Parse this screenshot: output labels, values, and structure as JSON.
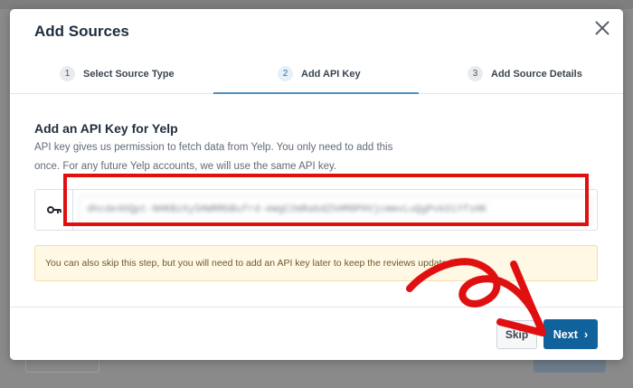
{
  "modal": {
    "title": "Add Sources"
  },
  "steps": [
    {
      "number": "1",
      "label": "Select Source Type"
    },
    {
      "number": "2",
      "label": "Add API Key"
    },
    {
      "number": "3",
      "label": "Add Source Details"
    }
  ],
  "active_step": 2,
  "content": {
    "heading": "Add an API Key for Yelp",
    "description": "API key gives us permission to fetch data from Yelp. You only need to add this once. For any future Yelp accounts, we will use the same API key.",
    "api_key_value": "dhcde4OQpt-NHKBzXy5HWRRbBufrd-eWgC2mRabdZhHM8PHVjcmmvLuQgPvkOiYfsHK",
    "key_icon": "key-icon"
  },
  "notice": {
    "text": "You can also skip this step, but you will need to add an API key later to keep the reviews updated."
  },
  "footer": {
    "skip_label": "Skip",
    "next_label": "Next",
    "next_chevron": "›"
  },
  "colors": {
    "primary_button": "#10629c",
    "highlight": "#e01010",
    "notice_background": "#fff8e5",
    "active_step_underline": "#4f8fc2"
  }
}
